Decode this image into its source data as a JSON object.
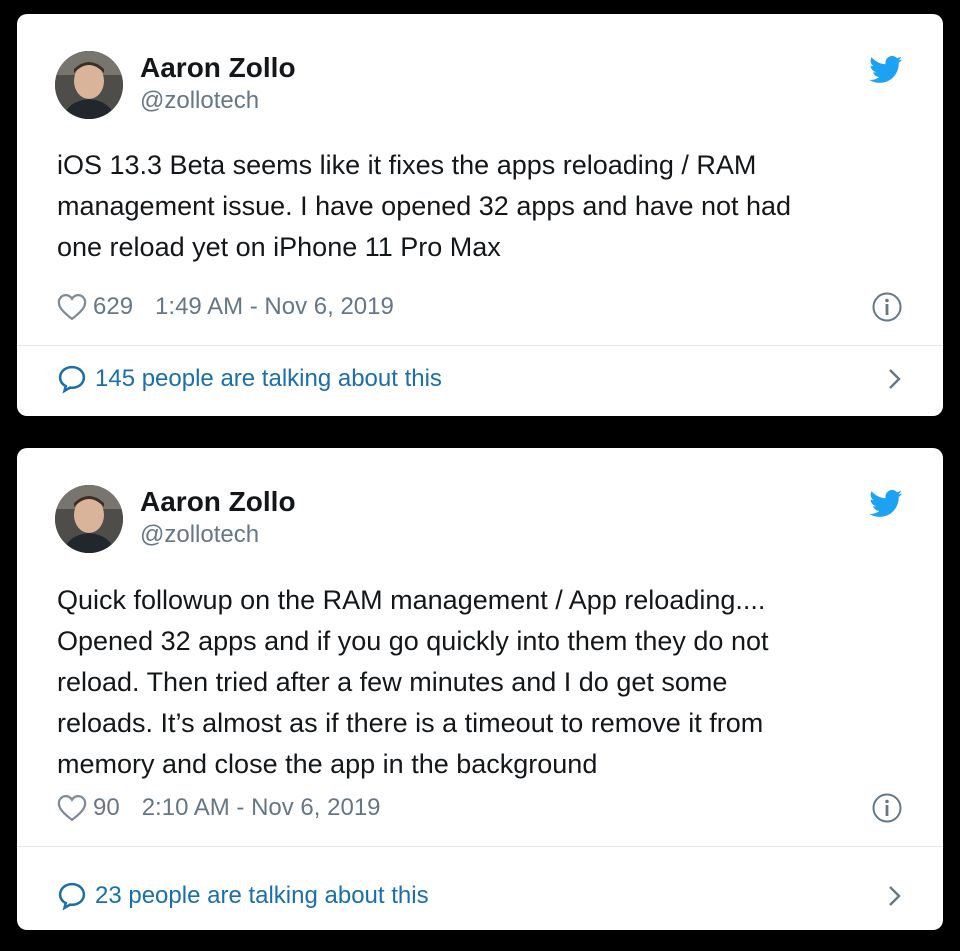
{
  "colors": {
    "background": "#000000",
    "card": "#ffffff",
    "name": "#14171a",
    "secondary": "#657786",
    "link": "#1b6fa8",
    "twitter_blue": "#1da1f2"
  },
  "tweets": [
    {
      "author": {
        "name": "Aaron Zollo",
        "handle": "@zollotech",
        "avatar_icon": "profile-photo"
      },
      "brand_icon": "twitter-bird-icon",
      "text_lines": [
        "iOS 13.3 Beta seems like it fixes the apps reloading / RAM",
        "management issue.  I have opened 32 apps and have not had",
        "one reload yet on iPhone 11 Pro Max"
      ],
      "likes": "629",
      "timestamp": "1:49 AM - Nov 6, 2019",
      "talking": "145 people are talking about this"
    },
    {
      "author": {
        "name": "Aaron Zollo",
        "handle": "@zollotech",
        "avatar_icon": "profile-photo"
      },
      "brand_icon": "twitter-bird-icon",
      "text_lines": [
        "Quick followup on the RAM management / App reloading....",
        "Opened 32 apps and if you go quickly into them they do not",
        "reload.  Then tried after a few minutes and I do get some",
        "reloads.  It’s almost as if there is a timeout to remove it from",
        "memory and close the app in the background"
      ],
      "likes": "90",
      "timestamp": "2:10 AM - Nov 6, 2019",
      "talking": "23 people are talking about this"
    }
  ]
}
